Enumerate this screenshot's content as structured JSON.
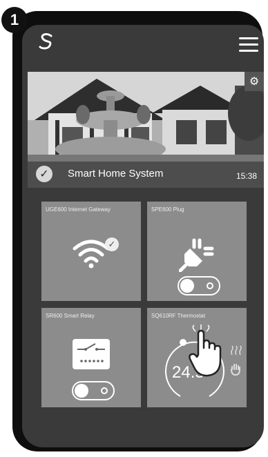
{
  "step_number": "1",
  "app": {
    "logo_icon": "s-logo-icon",
    "menu_icon": "hamburger-menu-icon"
  },
  "hero": {
    "title": "Smart Home System",
    "time": "15:38",
    "settings_icon": "gear-icon",
    "check_icon": "checkmark-icon"
  },
  "tiles": [
    {
      "label": "UGE600 Internet Gateway",
      "icon": "wifi-icon"
    },
    {
      "label": "SPE600 Plug",
      "icon": "plug-icon"
    },
    {
      "label": "SR600 Smart Relay",
      "icon": "relay-switch-icon"
    },
    {
      "label": "SQ610RF Thermostat",
      "icon": "thermostat-dial-icon",
      "temperature": "24.5°"
    }
  ],
  "colors": {
    "screen": "#3a3a3a",
    "tile": "#8c8c8c",
    "frame": "#0e0e0e"
  }
}
